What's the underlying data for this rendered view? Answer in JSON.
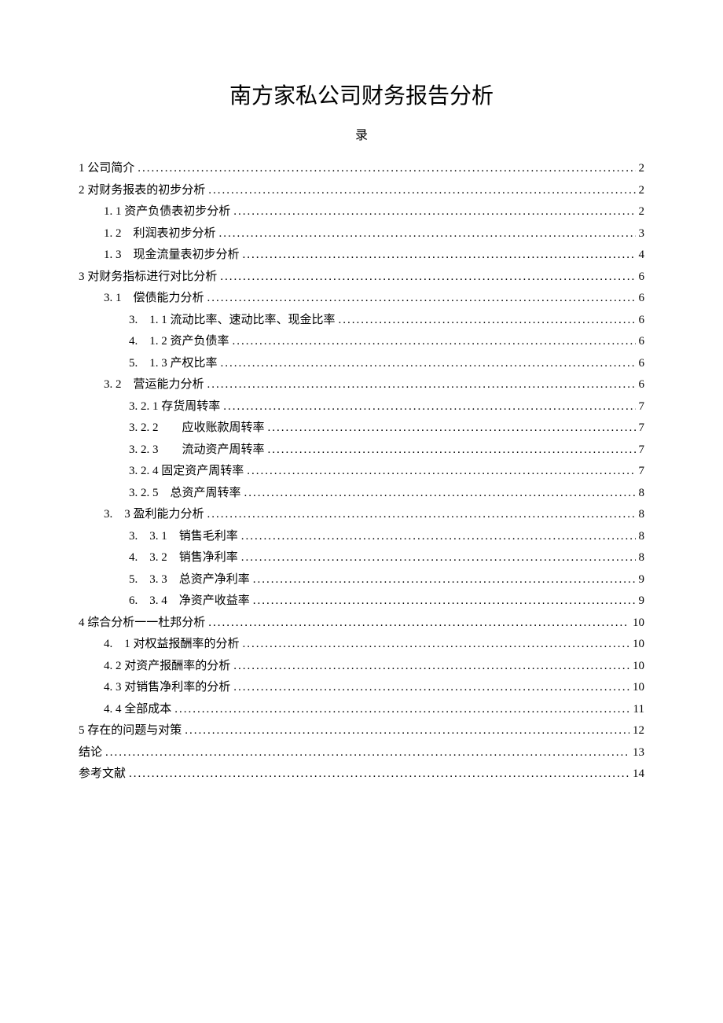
{
  "title": "南方家私公司财务报告分析",
  "subtitle": "录",
  "toc": [
    {
      "label": "1 公司简介",
      "page": "2",
      "indent": 0
    },
    {
      "label": "2 对财务报表的初步分析",
      "page": "2",
      "indent": 0
    },
    {
      "label": "1. 1 资产负债表初步分析",
      "page": "2",
      "indent": 1
    },
    {
      "label": "1. 2　利润表初步分析",
      "page": "3",
      "indent": 1
    },
    {
      "label": "1. 3　现金流量表初步分析",
      "page": "4",
      "indent": 1
    },
    {
      "label": "3 对财务指标进行对比分析",
      "page": "6",
      "indent": 0
    },
    {
      "label": "3. 1　偿债能力分析",
      "page": "6",
      "indent": 1
    },
    {
      "label": "3.　1. 1 流动比率、速动比率、现金比率",
      "page": "6",
      "indent": 2
    },
    {
      "label": "4.　1. 2 资产负债率",
      "page": "6",
      "indent": 2
    },
    {
      "label": "5.　1. 3 产权比率",
      "page": "6",
      "indent": 2
    },
    {
      "label": "3. 2　营运能力分析",
      "page": "6",
      "indent": 1
    },
    {
      "label": "3. 2. 1 存货周转率",
      "page": "7",
      "indent": 2
    },
    {
      "label": "3. 2. 2　　应收账款周转率",
      "page": "7",
      "indent": 2
    },
    {
      "label": "3. 2. 3　　流动资产周转率",
      "page": "7",
      "indent": 2
    },
    {
      "label": "3. 2. 4 固定资产周转率",
      "page": "7",
      "indent": 2
    },
    {
      "label": "3. 2. 5　总资产周转率",
      "page": "8",
      "indent": 2
    },
    {
      "label": "3.　3 盈利能力分析",
      "page": "8",
      "indent": 1
    },
    {
      "label": "3.　3. 1　销售毛利率",
      "page": "8",
      "indent": 2
    },
    {
      "label": "4.　3. 2　销售净利率",
      "page": "8",
      "indent": 2
    },
    {
      "label": "5.　3. 3　总资产净利率",
      "page": "9",
      "indent": 2
    },
    {
      "label": "6.　3. 4　净资产收益率",
      "page": "9",
      "indent": 2
    },
    {
      "label": "4 综合分析一一杜邦分析",
      "page": "10",
      "indent": 0
    },
    {
      "label": "4.　1 对权益报酬率的分析",
      "page": "10",
      "indent": 1
    },
    {
      "label": "4. 2 对资产报酬率的分析",
      "page": "10",
      "indent": 1
    },
    {
      "label": "4. 3 对销售净利率的分析",
      "page": "10",
      "indent": 1
    },
    {
      "label": "4. 4 全部成本",
      "page": "11",
      "indent": 1
    },
    {
      "label": "5 存在的问题与对策",
      "page": "12",
      "indent": 0
    },
    {
      "label": "结论",
      "page": "13",
      "indent": 0
    },
    {
      "label": "参考文献",
      "page": "14",
      "indent": 0
    }
  ]
}
